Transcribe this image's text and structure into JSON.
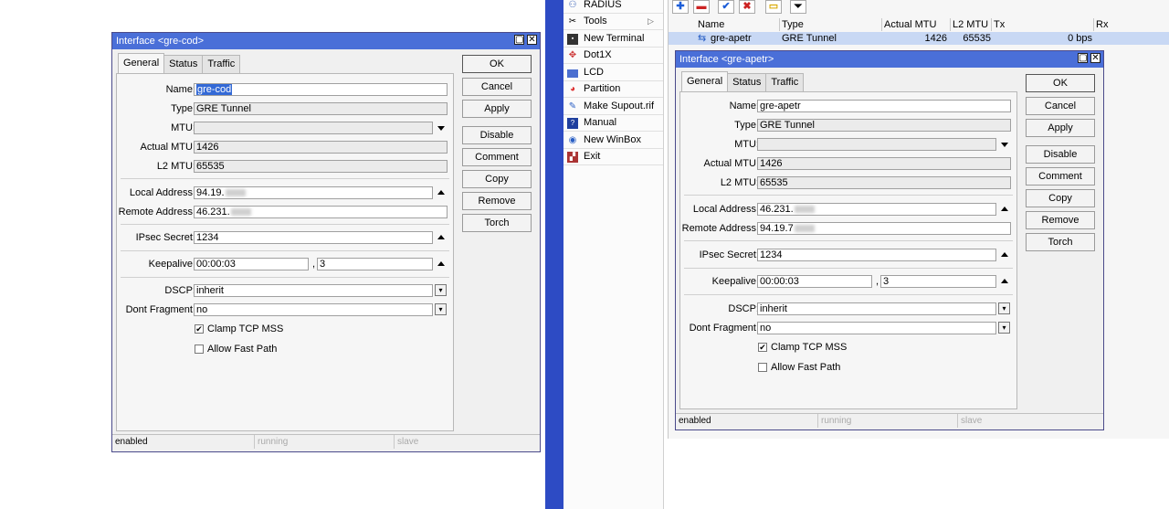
{
  "dialog1": {
    "title": "Interface <gre-cod>",
    "tabs": [
      "General",
      "Status",
      "Traffic"
    ],
    "labels": {
      "name": "Name:",
      "type": "Type:",
      "mtu": "MTU:",
      "actual_mtu": "Actual MTU:",
      "l2_mtu": "L2 MTU:",
      "local": "Local Address:",
      "remote": "Remote Address:",
      "ipsec": "IPsec Secret:",
      "keepalive": "Keepalive:",
      "dscp": "DSCP:",
      "dontfrag": "Dont Fragment:"
    },
    "values": {
      "name": "gre-cod",
      "type": "GRE Tunnel",
      "mtu": "",
      "actual_mtu": "1426",
      "l2_mtu": "65535",
      "local": "94.19.",
      "remote": "46.231.",
      "ipsec": "1234",
      "keepalive": "00:00:03",
      "keepalive2": "3",
      "dscp": "inherit",
      "dontfrag": "no"
    },
    "checkboxes": {
      "clamp": "Clamp TCP MSS",
      "fastpath": "Allow Fast Path"
    },
    "status": [
      "enabled",
      "running",
      "slave"
    ]
  },
  "dialog2": {
    "title": "Interface <gre-apetr>",
    "tabs": [
      "General",
      "Status",
      "Traffic"
    ],
    "values": {
      "name": "gre-apetr",
      "type": "GRE Tunnel",
      "mtu": "",
      "actual_mtu": "1426",
      "l2_mtu": "65535",
      "local": "46.231.",
      "remote": "94.19.7",
      "ipsec": "1234",
      "keepalive": "00:00:03",
      "keepalive2": "3",
      "dscp": "inherit",
      "dontfrag": "no"
    },
    "status": [
      "enabled",
      "running",
      "slave"
    ]
  },
  "buttons": [
    "OK",
    "Cancel",
    "Apply",
    "Disable",
    "Comment",
    "Copy",
    "Remove",
    "Torch"
  ],
  "separators": {
    "comma": ","
  },
  "menu": {
    "items": [
      {
        "label": "RADIUS",
        "icon": "radius-icon"
      },
      {
        "label": "Tools",
        "icon": "tools-icon"
      },
      {
        "label": "New Terminal",
        "icon": "terminal-icon"
      },
      {
        "label": "Dot1X",
        "icon": "dot1x-icon"
      },
      {
        "label": "LCD",
        "icon": "lcd-icon"
      },
      {
        "label": "Partition",
        "icon": "partition-icon"
      },
      {
        "label": "Make Supout.rif",
        "icon": "supout-icon"
      },
      {
        "label": "Manual",
        "icon": "manual-icon"
      },
      {
        "label": "New WinBox",
        "icon": "winbox-icon"
      },
      {
        "label": "Exit",
        "icon": "exit-icon"
      }
    ],
    "tools_arrow": "▷"
  },
  "list": {
    "headers": [
      "Name",
      "Type",
      "Actual MTU",
      "L2 MTU",
      "Tx",
      "Rx"
    ],
    "row": {
      "name": "gre-apetr",
      "type": "GRE Tunnel",
      "actual_mtu": "1426",
      "l2_mtu": "65535",
      "tx": "0 bps",
      "rx": ""
    }
  },
  "colors": {
    "titlebar": "#4a6fd8",
    "sidebar": "#2d4bc4",
    "selection": "#3369d6"
  }
}
